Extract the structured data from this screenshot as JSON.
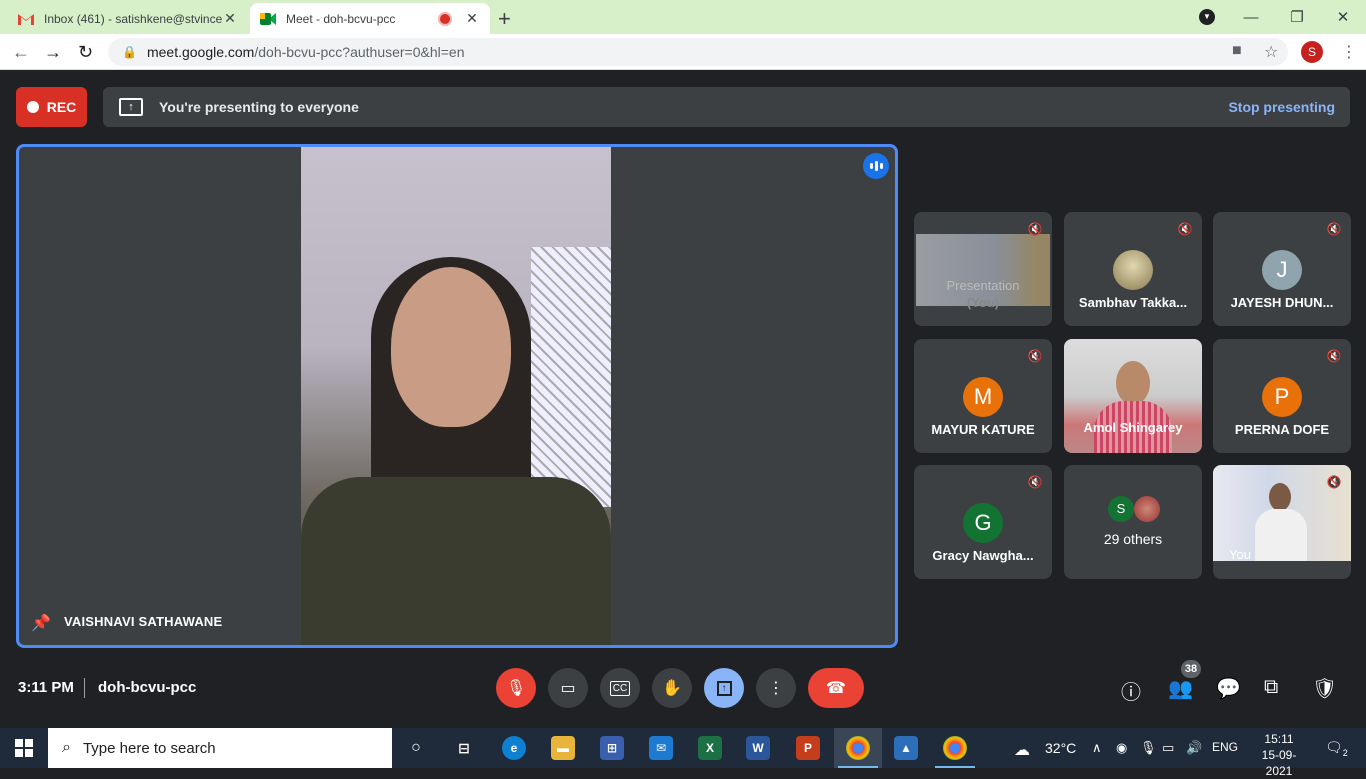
{
  "browser": {
    "tabs": [
      {
        "title": "Inbox (461) - satishkene@stvince",
        "favicon": "gmail-icon",
        "active": false
      },
      {
        "title": "Meet - doh-bcvu-pcc",
        "favicon": "meet-icon",
        "active": true,
        "recording": true
      }
    ],
    "url_host": "meet.google.com",
    "url_path": "/doh-bcvu-pcc?authuser=0&hl=en",
    "profile_initial": "S"
  },
  "meet": {
    "rec_label": "REC",
    "presenting_text": "You're presenting to everyone",
    "stop_presenting_label": "Stop presenting",
    "main_speaker": "VAISHNAVI SATHAWANE",
    "participants": [
      {
        "name": "(You)",
        "type": "screen",
        "overlay": "Presentation"
      },
      {
        "name": "Sambhav Takka...",
        "type": "photo-avatar"
      },
      {
        "name": "JAYESH DHUN...",
        "type": "initial",
        "initial": "J",
        "color": "#90a4ae"
      },
      {
        "name": "MAYUR KATURE",
        "type": "initial",
        "initial": "M",
        "color": "#e8710a"
      },
      {
        "name": "Amol Shingarey",
        "type": "video"
      },
      {
        "name": "PRERNA DOFE",
        "type": "initial",
        "initial": "P",
        "color": "#e8710a"
      },
      {
        "name": "Gracy Nawgha...",
        "type": "initial",
        "initial": "G",
        "color": "#137333"
      },
      {
        "name": "29 others",
        "type": "others",
        "initial": "S",
        "color": "#137333"
      },
      {
        "name": "You",
        "type": "video"
      }
    ],
    "time": "3:11 PM",
    "meeting_code": "doh-bcvu-pcc",
    "people_count": "38"
  },
  "taskbar": {
    "search_placeholder": "Type here to search",
    "weather": "32°C",
    "language": "ENG",
    "time": "15:11",
    "date": "15-09-2021",
    "notifications": "2"
  }
}
